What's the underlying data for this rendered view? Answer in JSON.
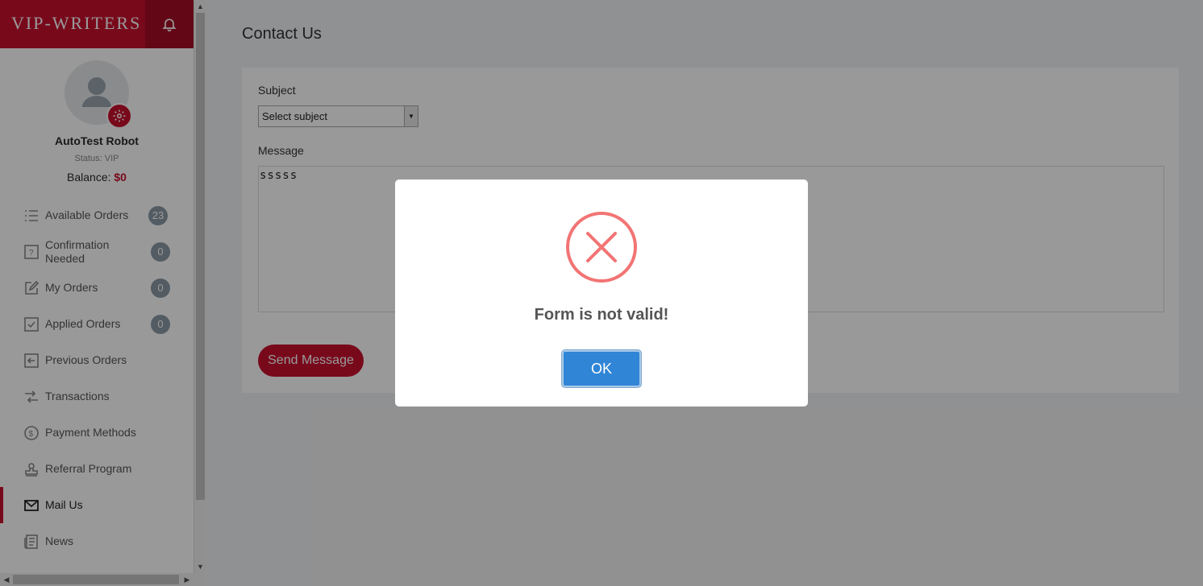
{
  "brand": {
    "logo_text": "VIP-WRITERS"
  },
  "user": {
    "name": "AutoTest Robot",
    "status": "Status: VIP",
    "balance_label": "Balance:",
    "balance_value": "$0"
  },
  "nav": {
    "items": [
      {
        "label": "Available Orders",
        "count": "23",
        "icon": "list-icon"
      },
      {
        "label": "Confirmation Needed",
        "count": "0",
        "icon": "question-box-icon"
      },
      {
        "label": "My Orders",
        "count": "0",
        "icon": "edit-icon"
      },
      {
        "label": "Applied Orders",
        "count": "0",
        "icon": "checkbox-icon"
      },
      {
        "label": "Previous Orders",
        "icon": "arrow-left-box-icon"
      },
      {
        "label": "Transactions",
        "icon": "transfer-icon"
      },
      {
        "label": "Payment Methods",
        "icon": "dollar-circle-icon"
      },
      {
        "label": "Referral Program",
        "icon": "stamp-icon"
      },
      {
        "label": "Mail Us",
        "icon": "envelope-icon",
        "active": true
      },
      {
        "label": "News",
        "icon": "newspaper-icon"
      }
    ]
  },
  "main": {
    "title": "Contact Us",
    "form": {
      "subject_label": "Subject",
      "subject_value": "Select subject",
      "message_label": "Message",
      "message_value": "sssss",
      "send_label": "Send Message"
    }
  },
  "modal": {
    "title": "Form is not valid!",
    "ok_label": "OK",
    "icon": "error-x-icon"
  },
  "colors": {
    "brand": "#c8102e",
    "ok_button": "#3085d6",
    "error": "#f27474"
  }
}
